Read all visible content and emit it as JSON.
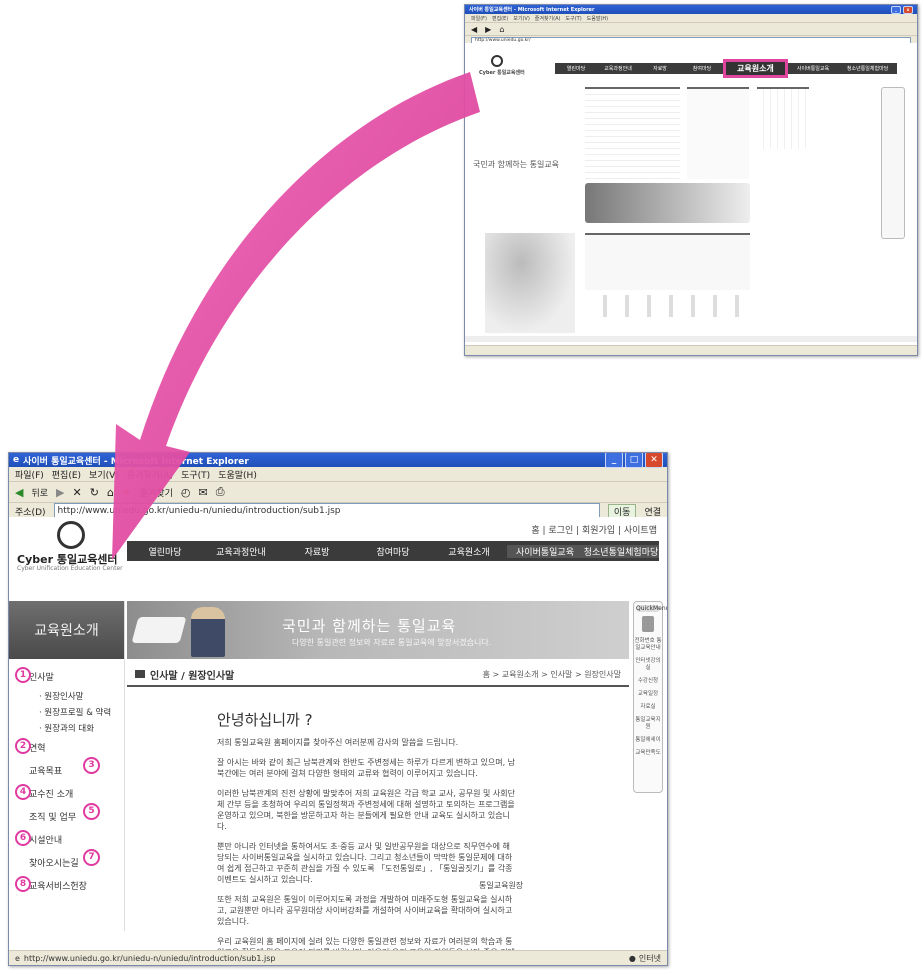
{
  "small_window": {
    "title": "사이버 통일교육센터 - Microsoft Internet Explorer",
    "menu": [
      "파일(F)",
      "편집(E)",
      "보기(V)",
      "즐겨찾기(A)",
      "도구(T)",
      "도움말(H)"
    ],
    "address": "http://www.uniedu.go.kr/",
    "logo": "Cyber 통일교육센터",
    "nav": [
      "열린마당",
      "교육과정안내",
      "자료방",
      "참여마당",
      "교육원소개",
      "사이버통일교육",
      "청소년통일체험마당"
    ],
    "highlight_tab": "교육원소개",
    "slogan": "국민과 함께하는 통일교육"
  },
  "big_window": {
    "title": "사이버 통일교육센터 - Microsoft Internet Explorer",
    "menu": [
      "파일(F)",
      "편집(E)",
      "보기(V)",
      "즐겨찾기(A)",
      "도구(T)",
      "도움말(H)"
    ],
    "toolbar": {
      "back": "뒤로",
      "favorites": "즐겨찾기"
    },
    "address_label": "주소(D)",
    "address": "http://www.uniedu.go.kr/uniedu-n/uniedu/introduction/sub1.jsp",
    "go_label": "이동",
    "links_label": "연결",
    "site": {
      "logo": "Cyber 통일교육센터",
      "logo_sub": "Cyber Unification Education Center",
      "util_nav": "홈 | 로그인 | 회원가입 | 사이트맵",
      "main_nav": [
        "열린마당",
        "교육과정안내",
        "자료방",
        "참여마당",
        "교육원소개",
        "사이버통일교육",
        "청소년통일체험마당"
      ],
      "section_title": "교육원소개",
      "banner_slogan": "국민과 함께하는 통일교육",
      "banner_sub": "다양한 통일관련 정보와 자료로 통일교육에 앞장서겠습니다.",
      "left_nav": [
        {
          "num": "1",
          "label": "인사말"
        },
        {
          "sub": "원장인사말"
        },
        {
          "sub": "원장프로필 & 약력"
        },
        {
          "sub": "원장과의 대화"
        },
        {
          "num": "2",
          "label": "연혁"
        },
        {
          "label": "교육목표"
        },
        {
          "num": "4",
          "label": "교수진 소개"
        },
        {
          "label": "조직 및 업무"
        },
        {
          "num": "6",
          "label": "시설안내"
        },
        {
          "label": "찾아오시는길"
        },
        {
          "num": "8",
          "label": "교육서비스헌장"
        }
      ],
      "right_numbers": [
        "3",
        "5",
        "7"
      ],
      "page_title": "인사말 / 원장인사말",
      "breadcrumb": "홈 > 교육원소개 > 인사말 > 원장인사말",
      "greeting": "안녕하십니까 ?",
      "paragraphs": [
        "저희 통일교육원 홈페이지를 찾아주신 여러분께 감사의 말씀을 드립니다.",
        "잘 아시는 바와 같이 최근 남북관계와 한반도 주변정세는 하루가 다르게 변하고 있으며, 남북간에는 여러 분야에 걸쳐 다양한 형태의 교류와 협력이 이루어지고 있습니다.",
        "이러한 남북관계의 진전 상황에 발맞추어 저희 교육원은 각급 학교 교사, 공무원 및 사회단체 간부 등을 초청하여 우리의 통일정책과 주변정세에 대해 설명하고 토의하는 프로그램을 운영하고 있으며, 북한을 방문하고자 하는 분들에게 필요한 안내 교육도 실시하고 있습니다.",
        "뿐만 아니라 인터넷을 통하여서도 초·중등 교사 및 일반공무원을 대상으로 직무연수에 해당되는 사이버통일교육을 실시하고 있습니다. 그리고 청소년들이 막막한 통일문제에 대하여 쉽게 접근하고 꾸준히 관심을 가질 수 있도록 「도전통일로」, 「통일골짓기」를 각종 이벤트도 실시하고 있습니다.",
        "또한 저희 교육원은 통일이 이루어지도록 과정을 개발하여 미래주도형 통일교육을 실시하고, 교원뿐만 아니라 공무원대상 사이버강좌를 개설하여 사이버교육을 확대하여 실시하고 있습니다.",
        "우리 교육원의 홈 페이지에 실려 있는 다양한 통일관련 정보와 자료가 여러분의 학습과 통일교육 활동에 많은 도움이 되기를 바랍니다. 아울러 우리 교육원 직원들은 보다 좋은 컨텐츠를 제공하기 위해 최선을 다할 것을 약속드립니다. 감사합니다."
      ],
      "signature": "통일교육원장",
      "quick_menu": [
        "QuickMenu",
        "전화번호 통일교육안내",
        "인터넷강의실",
        "수강신청",
        "교육일정",
        "자료실",
        "통일교육지원",
        "통일에세이",
        "교육만족도"
      ]
    },
    "status_url": "http://www.uniedu.go.kr/uniedu-n/uniedu/introduction/sub1.jsp",
    "status_zone": "인터넷"
  },
  "colors": {
    "arrow": "#e0459f",
    "nav_bg": "#3b3b3b",
    "title_bar": "#2254c8"
  }
}
